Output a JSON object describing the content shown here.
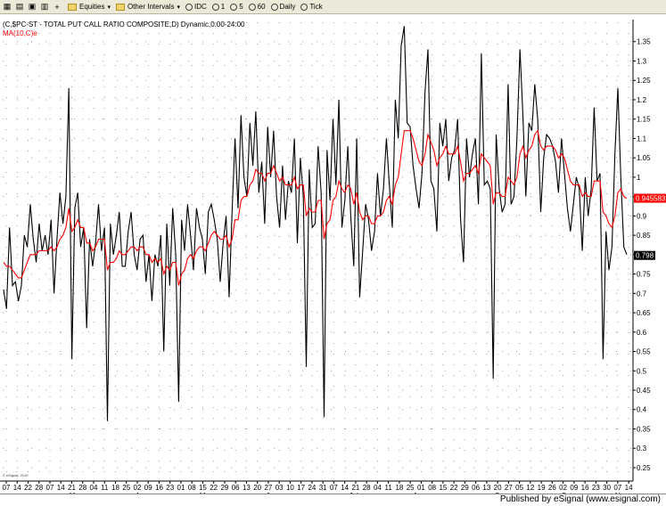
{
  "toolbar": {
    "equities_label": "Equities",
    "other_intervals_label": "Other Intervals",
    "intervals": [
      "IDC",
      "1",
      "5",
      "60",
      "Daily",
      "Tick"
    ]
  },
  "chart_header": {
    "title": "(C,$PC-ST - TOTAL PUT CALL RATIO COMPOSITE,D) Dynamic,0:00-24:00",
    "ma_label": "MA(10,C)e"
  },
  "watermark": "© eSignal, 2010",
  "published": "Published by eSignal (www.esignal.com)",
  "colors": {
    "price_line": "#000000",
    "ma_line": "#ff0000",
    "grid": "#999999",
    "ma_box": "#ff0000",
    "last_box": "#000000"
  },
  "chart_data": {
    "type": "line",
    "title": "(C,$PC-ST - TOTAL PUT CALL RATIO COMPOSITE,D) Dynamic,0:00-24:00",
    "ylim": [
      0.22,
      1.4
    ],
    "y_ticks": [
      "1.35",
      "1.3",
      "1.25",
      "1.2",
      "1.15",
      "1.1",
      "1.05",
      "1",
      "0.95",
      "0.9",
      "0.85",
      "0.8",
      "0.75",
      "0.7",
      "0.65",
      "0.6",
      "0.55",
      "0.5",
      "0.45",
      "0.4",
      "0.35",
      "0.3",
      "0.25"
    ],
    "x_ticks": [
      "07",
      "14",
      "22",
      "28",
      "07",
      "14",
      "21",
      "28",
      "04",
      "11",
      "18",
      "25",
      "02",
      "09",
      "16",
      "23",
      "01",
      "08",
      "15",
      "22",
      "29",
      "06",
      "13",
      "20",
      "27",
      "03",
      "10",
      "17",
      "24",
      "31",
      "07",
      "14",
      "21",
      "28",
      "04",
      "11",
      "18",
      "25",
      "01",
      "08",
      "15",
      "22",
      "29",
      "06",
      "13",
      "20",
      "27",
      "05",
      "12",
      "19",
      "26",
      "02",
      "09",
      "16",
      "23",
      "30",
      "07",
      "14"
    ],
    "month_labels": [
      "Mar",
      "Apr",
      "May",
      "Jun",
      "Jul",
      "Aug",
      "Sep",
      "Oct",
      "Nov"
    ],
    "last_values": {
      "ma": "0.945583",
      "close": "0.798"
    },
    "series": [
      {
        "name": "",
        "values": [
          0.71,
          0.66,
          0.87,
          0.72,
          0.73,
          0.68,
          0.72,
          0.85,
          0.82,
          0.93,
          0.84,
          0.78,
          0.88,
          0.81,
          0.85,
          0.8,
          0.89,
          0.7,
          0.84,
          0.96,
          0.88,
          0.95,
          1.23,
          0.53,
          0.92,
          0.96,
          0.82,
          0.87,
          0.61,
          0.84,
          0.77,
          0.83,
          0.93,
          0.81,
          0.87,
          0.37,
          0.88,
          0.8,
          0.85,
          0.91,
          0.77,
          0.77,
          0.86,
          0.91,
          0.8,
          0.76,
          0.84,
          0.85,
          0.73,
          0.8,
          0.68,
          0.8,
          0.77,
          0.85,
          0.55,
          0.88,
          0.72,
          0.92,
          0.8,
          0.42,
          0.89,
          0.81,
          0.93,
          0.85,
          0.76,
          0.92,
          0.87,
          0.84,
          0.75,
          0.91,
          0.93,
          0.89,
          0.84,
          0.73,
          0.83,
          0.9,
          0.69,
          0.91,
          1.1,
          0.92,
          1.16,
          1.0,
          0.95,
          1.14,
          1.03,
          1.17,
          0.96,
          1.04,
          0.88,
          1.13,
          1.0,
          1.12,
          0.95,
          0.87,
          1.03,
          0.89,
          0.99,
          0.96,
          1.1,
          0.83,
          1.05,
          0.95,
          0.51,
          1.02,
          0.87,
          0.88,
          1.08,
          0.96,
          0.38,
          1.07,
          0.94,
          1.15,
          0.98,
          1.2,
          0.87,
          0.94,
          1.08,
          0.9,
          0.77,
          1.1,
          0.69,
          0.81,
          0.93,
          0.89,
          0.81,
          0.86,
          1.01,
          0.9,
          0.97,
          1.1,
          0.98,
          0.87,
          1.2,
          1.1,
          1.34,
          1.39,
          1.14,
          1.13,
          1.03,
          0.97,
          0.92,
          1.01,
          1.22,
          1.33,
          0.99,
          0.97,
          0.86,
          1.14,
          1.08,
          1.15,
          0.99,
          1.05,
          1.07,
          1.15,
          0.89,
          0.78,
          1.1,
          1.0,
          1.06,
          1.1,
          0.93,
          1.32,
          0.98,
          0.99,
          0.97,
          0.48,
          1.11,
          0.97,
          0.91,
          0.93,
          1.24,
          0.93,
          0.95,
          1.1,
          1.33,
          1.16,
          0.95,
          1.14,
          1.12,
          1.24,
          1.15,
          0.91,
          1.05,
          1.11,
          1.1,
          1.08,
          1.04,
          0.96,
          1.1,
          1.01,
          0.92,
          0.86,
          0.93,
          1.0,
          0.97,
          0.81,
          1.0,
          0.9,
          0.97,
          1.18,
          0.99,
          1.01,
          0.53,
          0.86,
          0.76,
          0.82,
          1.06,
          1.23,
          1.0,
          0.82,
          0.8
        ]
      },
      {
        "name": "MA(10,C)e",
        "values": [
          0.78,
          0.77,
          0.77,
          0.76,
          0.75,
          0.74,
          0.74,
          0.76,
          0.78,
          0.8,
          0.8,
          0.8,
          0.81,
          0.81,
          0.81,
          0.81,
          0.82,
          0.81,
          0.82,
          0.84,
          0.85,
          0.87,
          0.92,
          0.86,
          0.87,
          0.89,
          0.87,
          0.87,
          0.83,
          0.83,
          0.81,
          0.82,
          0.84,
          0.84,
          0.84,
          0.76,
          0.78,
          0.78,
          0.79,
          0.81,
          0.8,
          0.8,
          0.81,
          0.82,
          0.82,
          0.81,
          0.82,
          0.82,
          0.8,
          0.8,
          0.78,
          0.79,
          0.78,
          0.79,
          0.75,
          0.77,
          0.76,
          0.78,
          0.78,
          0.72,
          0.75,
          0.76,
          0.79,
          0.8,
          0.79,
          0.81,
          0.82,
          0.82,
          0.81,
          0.83,
          0.85,
          0.86,
          0.85,
          0.84,
          0.84,
          0.85,
          0.82,
          0.84,
          0.89,
          0.89,
          0.94,
          0.95,
          0.95,
          0.98,
          0.99,
          1.02,
          1.01,
          1.01,
          0.99,
          1.01,
          1.01,
          1.03,
          1.01,
          0.99,
          1.0,
          0.98,
          0.98,
          0.98,
          1.0,
          0.97,
          0.98,
          0.98,
          0.9,
          0.92,
          0.91,
          0.91,
          0.94,
          0.94,
          0.84,
          0.88,
          0.89,
          0.94,
          0.95,
          0.99,
          0.97,
          0.96,
          0.98,
          0.97,
          0.93,
          0.96,
          0.91,
          0.89,
          0.9,
          0.9,
          0.88,
          0.88,
          0.9,
          0.9,
          0.91,
          0.94,
          0.95,
          0.93,
          0.98,
          1.0,
          1.06,
          1.12,
          1.12,
          1.12,
          1.1,
          1.07,
          1.04,
          1.03,
          1.06,
          1.11,
          1.09,
          1.07,
          1.03,
          1.05,
          1.06,
          1.08,
          1.06,
          1.06,
          1.06,
          1.08,
          1.04,
          0.99,
          1.01,
          1.01,
          1.02,
          1.03,
          1.01,
          1.06,
          1.05,
          1.04,
          1.03,
          0.93,
          0.96,
          0.96,
          0.95,
          0.95,
          1.0,
          0.99,
          0.98,
          1.0,
          1.06,
          1.08,
          1.05,
          1.07,
          1.08,
          1.11,
          1.12,
          1.08,
          1.07,
          1.08,
          1.08,
          1.08,
          1.07,
          1.05,
          1.06,
          1.05,
          1.02,
          0.99,
          0.98,
          0.98,
          0.98,
          0.95,
          0.96,
          0.95,
          0.95,
          0.99,
          0.99,
          0.99,
          0.91,
          0.9,
          0.88,
          0.87,
          0.9,
          0.96,
          0.97,
          0.95,
          0.945583
        ]
      }
    ]
  }
}
